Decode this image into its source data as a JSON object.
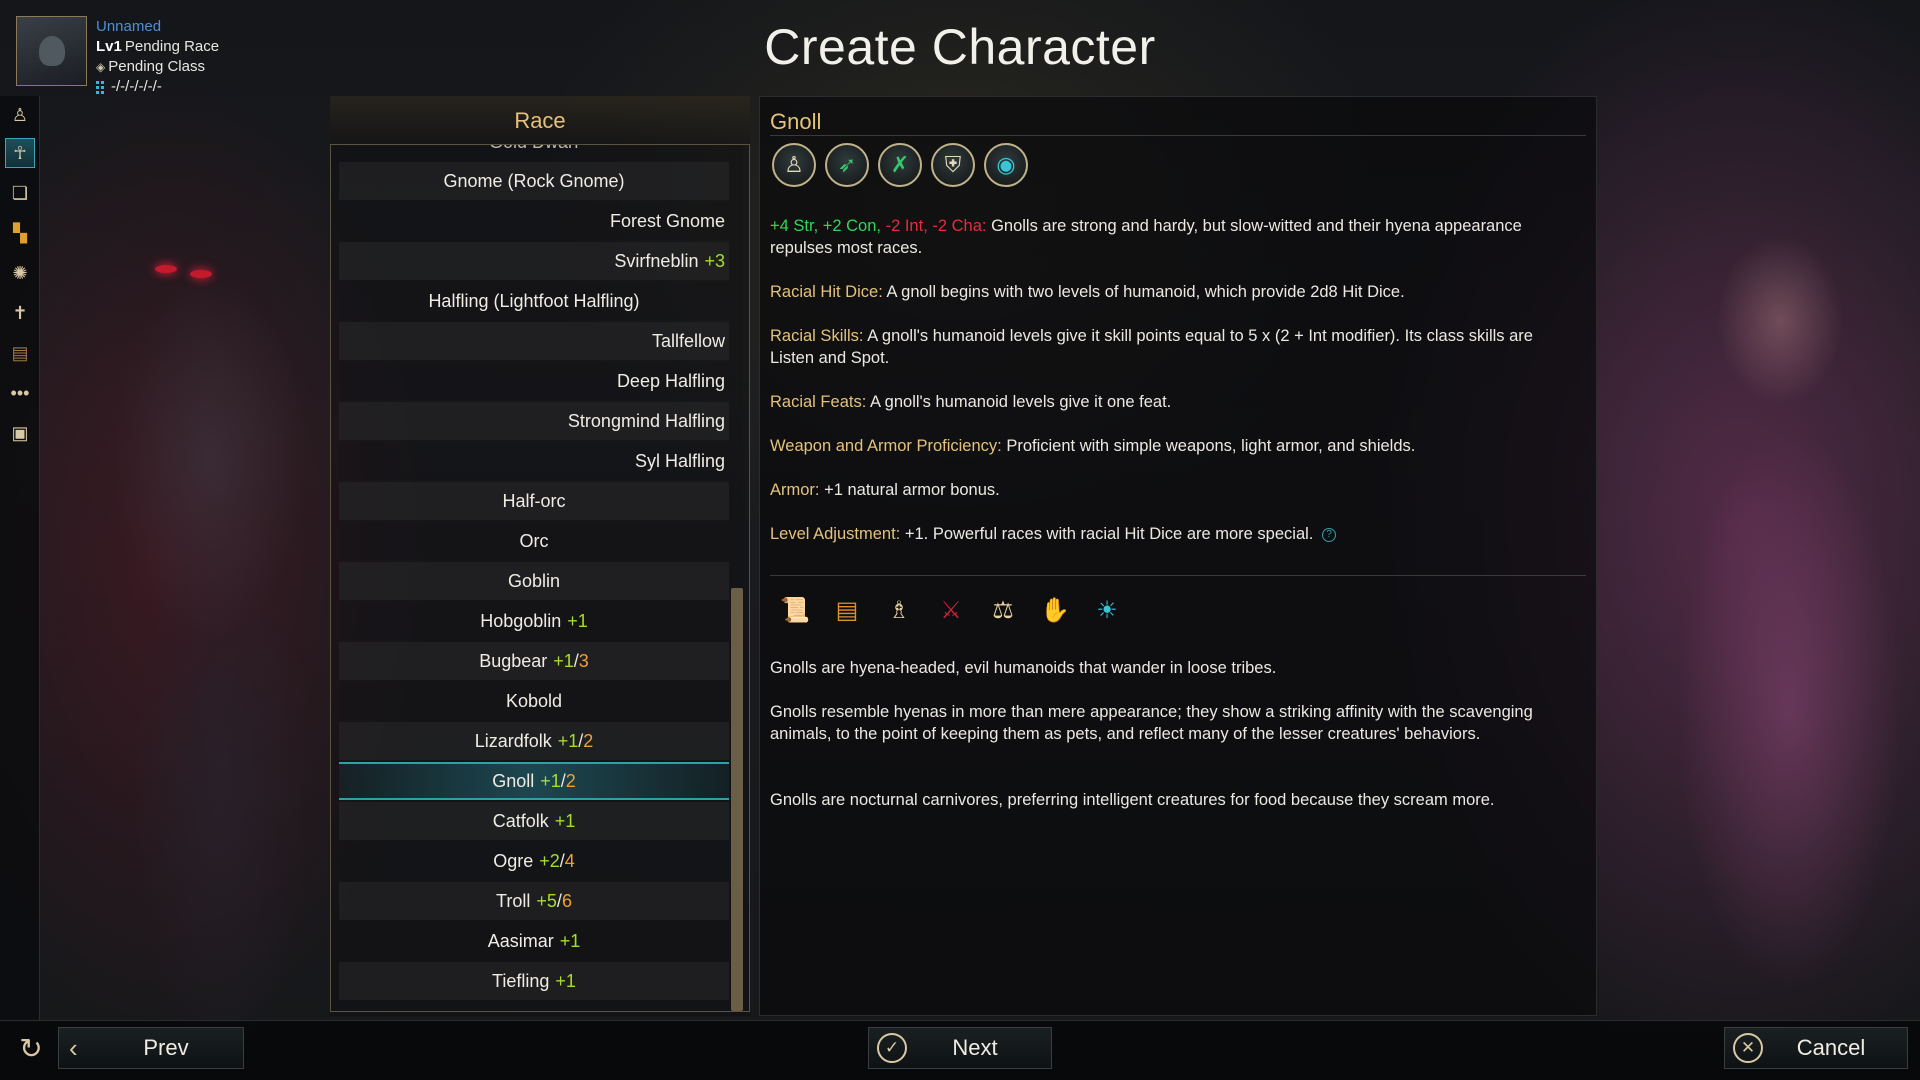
{
  "header": {
    "title": "Create Character",
    "char_name": "Unnamed",
    "level": "Lv1",
    "race": "Pending Race",
    "class": "Pending Class",
    "stats": "-/-/-/-/-/-"
  },
  "rail": {
    "items": [
      "figure-icon",
      "race-icon",
      "book-icon",
      "grid-icon",
      "skills-icon",
      "feats-icon",
      "spellbook-icon",
      "more-icon",
      "portrait-card-icon"
    ]
  },
  "race_panel": {
    "header": "Race",
    "partial_top": "Gold Dwarf",
    "rows": [
      {
        "name": "Gnome (Rock Gnome)",
        "la": "",
        "la2": "",
        "align": "center"
      },
      {
        "name": "Forest Gnome",
        "la": "",
        "la2": "",
        "align": "right"
      },
      {
        "name": "Svirfneblin",
        "la": "+3",
        "la2": "",
        "align": "right"
      },
      {
        "name": "Halfling (Lightfoot Halfling)",
        "la": "",
        "la2": "",
        "align": "center"
      },
      {
        "name": "Tallfellow",
        "la": "",
        "la2": "",
        "align": "right"
      },
      {
        "name": "Deep Halfling",
        "la": "",
        "la2": "",
        "align": "right"
      },
      {
        "name": "Strongmind Halfling",
        "la": "",
        "la2": "",
        "align": "right"
      },
      {
        "name": "Syl Halfling",
        "la": "",
        "la2": "",
        "align": "right"
      },
      {
        "name": "Half-orc",
        "la": "",
        "la2": "",
        "align": "center"
      },
      {
        "name": "Orc",
        "la": "",
        "la2": "",
        "align": "center"
      },
      {
        "name": "Goblin",
        "la": "",
        "la2": "",
        "align": "center"
      },
      {
        "name": "Hobgoblin",
        "la": "+1",
        "la2": "",
        "align": "center"
      },
      {
        "name": "Bugbear",
        "la": "+1",
        "la2": "3",
        "align": "center"
      },
      {
        "name": "Kobold",
        "la": "",
        "la2": "",
        "align": "center"
      },
      {
        "name": "Lizardfolk",
        "la": "+1",
        "la2": "2",
        "align": "center"
      },
      {
        "name": "Gnoll",
        "la": "+1",
        "la2": "2",
        "align": "center",
        "selected": true
      },
      {
        "name": "Catfolk",
        "la": "+1",
        "la2": "",
        "align": "center"
      },
      {
        "name": "Ogre",
        "la": "+2",
        "la2": "4",
        "align": "center"
      },
      {
        "name": "Troll",
        "la": "+5",
        "la2": "6",
        "align": "center"
      },
      {
        "name": "Aasimar",
        "la": "+1",
        "la2": "",
        "align": "center"
      },
      {
        "name": "Tiefling",
        "la": "+1",
        "la2": "",
        "align": "center"
      }
    ]
  },
  "detail": {
    "title": "Gnoll",
    "trait_icons": [
      "humanoid-icon",
      "running-icon",
      "bow-crossed-icon",
      "armor-shield-icon",
      "eye-icon"
    ],
    "ability_adj_pos": "+4 Str, +2 Con,",
    "ability_adj_neg": "-2 Int, -2 Cha:",
    "ability_text": "Gnolls are strong and hardy, but slow-witted and their hyena appearance repulses most races.",
    "hitdice_label": "Racial Hit Dice:",
    "hitdice_text": "A gnoll begins with two levels of humanoid, which provide 2d8 Hit Dice.",
    "skills_label": "Racial Skills:",
    "skills_text": "A gnoll's humanoid levels give it skill points equal to 5 x (2 + Int modifier). Its class skills are Listen and Spot.",
    "feats_label": "Racial Feats:",
    "feats_text": "A gnoll's humanoid levels give it one feat.",
    "weapon_label": "Weapon and Armor Proficiency:",
    "weapon_text": "Proficient with simple weapons, light armor, and shields.",
    "armor_label": "Armor:",
    "armor_text": "+1 natural armor bonus.",
    "la_label": "Level Adjustment:",
    "la_text": "+1. Powerful races with racial Hit Dice are more special.",
    "help_mark": "?",
    "lore_icons": [
      "scroll-icon",
      "orange-scroll-icon",
      "figure-heart-icon",
      "crossed-swords-icon",
      "city-scales-icon",
      "handshake-icon",
      "deity-icon"
    ],
    "lore_1": "Gnolls are hyena-headed, evil humanoids that wander in loose tribes.",
    "lore_2": "Gnolls resemble hyenas in more than mere appearance; they show a striking affinity with the scavenging animals, to the point of keeping them as pets, and reflect many of the lesser creatures' behaviors.",
    "lore_3": "Gnolls are nocturnal carnivores, preferring intelligent creatures for food because they scream more."
  },
  "footer": {
    "prev": "Prev",
    "next": "Next",
    "cancel": "Cancel"
  },
  "colors": {
    "gold_label": "#e4c27a",
    "stat_positive": "#33d45c",
    "stat_negative": "#e42c3c",
    "la_green": "#a6dc2c",
    "la_orange": "#f0a030",
    "selection_teal": "#2fa0a8"
  }
}
